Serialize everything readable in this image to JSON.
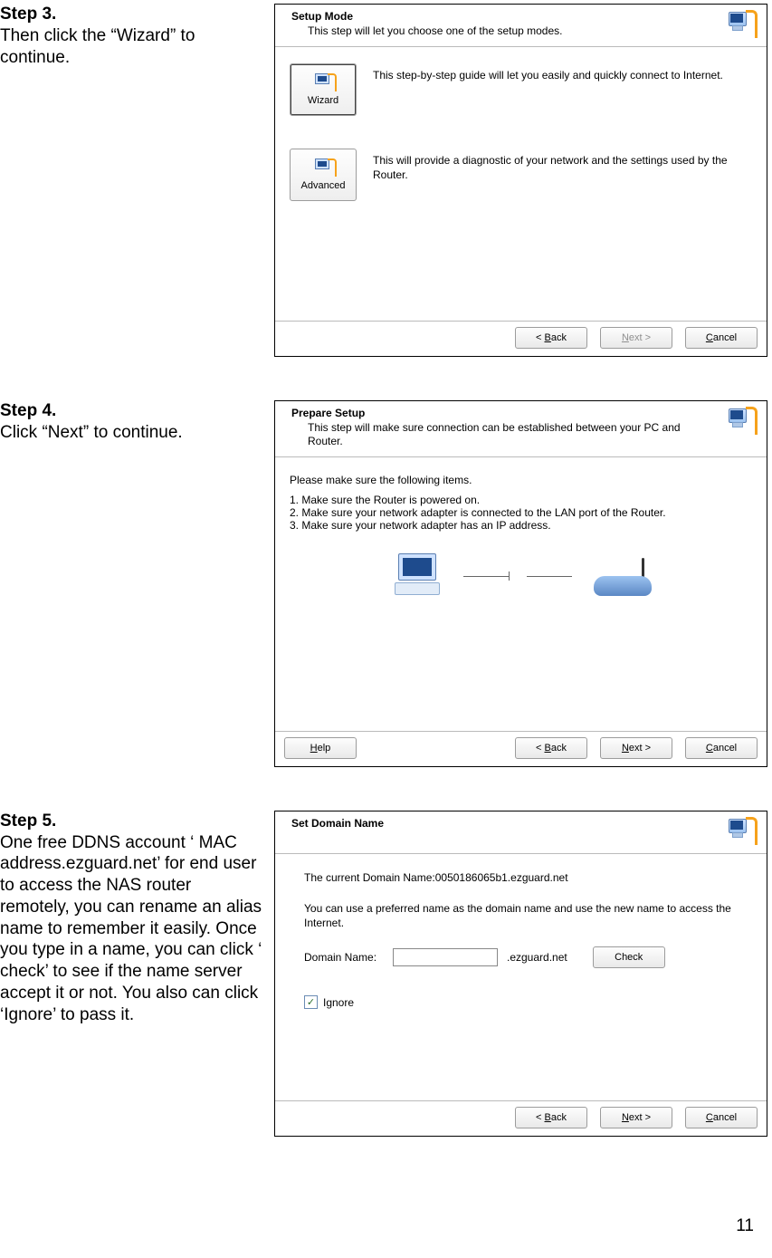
{
  "step3": {
    "heading": "Step 3.",
    "text": "Then click the “Wizard” to continue.",
    "panel": {
      "title": "Setup Mode",
      "subtitle": "This step will let you choose one of the setup modes.",
      "options": [
        {
          "label": "Wizard",
          "desc": "This step-by-step guide will let you easily and quickly connect to Internet."
        },
        {
          "label": "Advanced",
          "desc": "This will provide a diagnostic of your network and the settings used by the Router."
        }
      ],
      "buttons": {
        "back": "< Back",
        "next": "Next >",
        "cancel": "Cancel"
      }
    }
  },
  "step4": {
    "heading": "Step 4.",
    "text": "Click “Next” to continue.",
    "panel": {
      "title": "Prepare Setup",
      "subtitle": "This step will make sure connection can be established between your PC and Router.",
      "intro": "Please make sure the following items.",
      "items": [
        "Make sure the Router is powered on.",
        "Make sure your network adapter is connected to the LAN port of the Router.",
        "Make sure your network adapter has an IP address."
      ],
      "buttons": {
        "help": "Help",
        "back": "< Back",
        "next": "Next >",
        "cancel": "Cancel"
      }
    }
  },
  "step5": {
    "heading": "Step 5.",
    "text": "One free DDNS account ‘ MAC address.ezguard.net’ for end user to access the NAS router remotely, you can rename an alias name to remember it easily. Once you type in a name, you can click ‘ check’ to see if the name server accept it or not. You also can click ‘Ignore’ to pass it.",
    "panel": {
      "title": "Set Domain Name",
      "current": "The current Domain Name:0050186065b1.ezguard.net",
      "hint": "You can use a preferred name as the domain name and use the new name to access the Internet.",
      "domain_label": "Domain Name:",
      "domain_value": "",
      "domain_suffix": ".ezguard.net",
      "check": "Check",
      "ignore_label": "Ignore",
      "ignore_checked": "✓",
      "buttons": {
        "back": "< Back",
        "next": "Next >",
        "cancel": "Cancel"
      }
    }
  },
  "page_number": "11"
}
